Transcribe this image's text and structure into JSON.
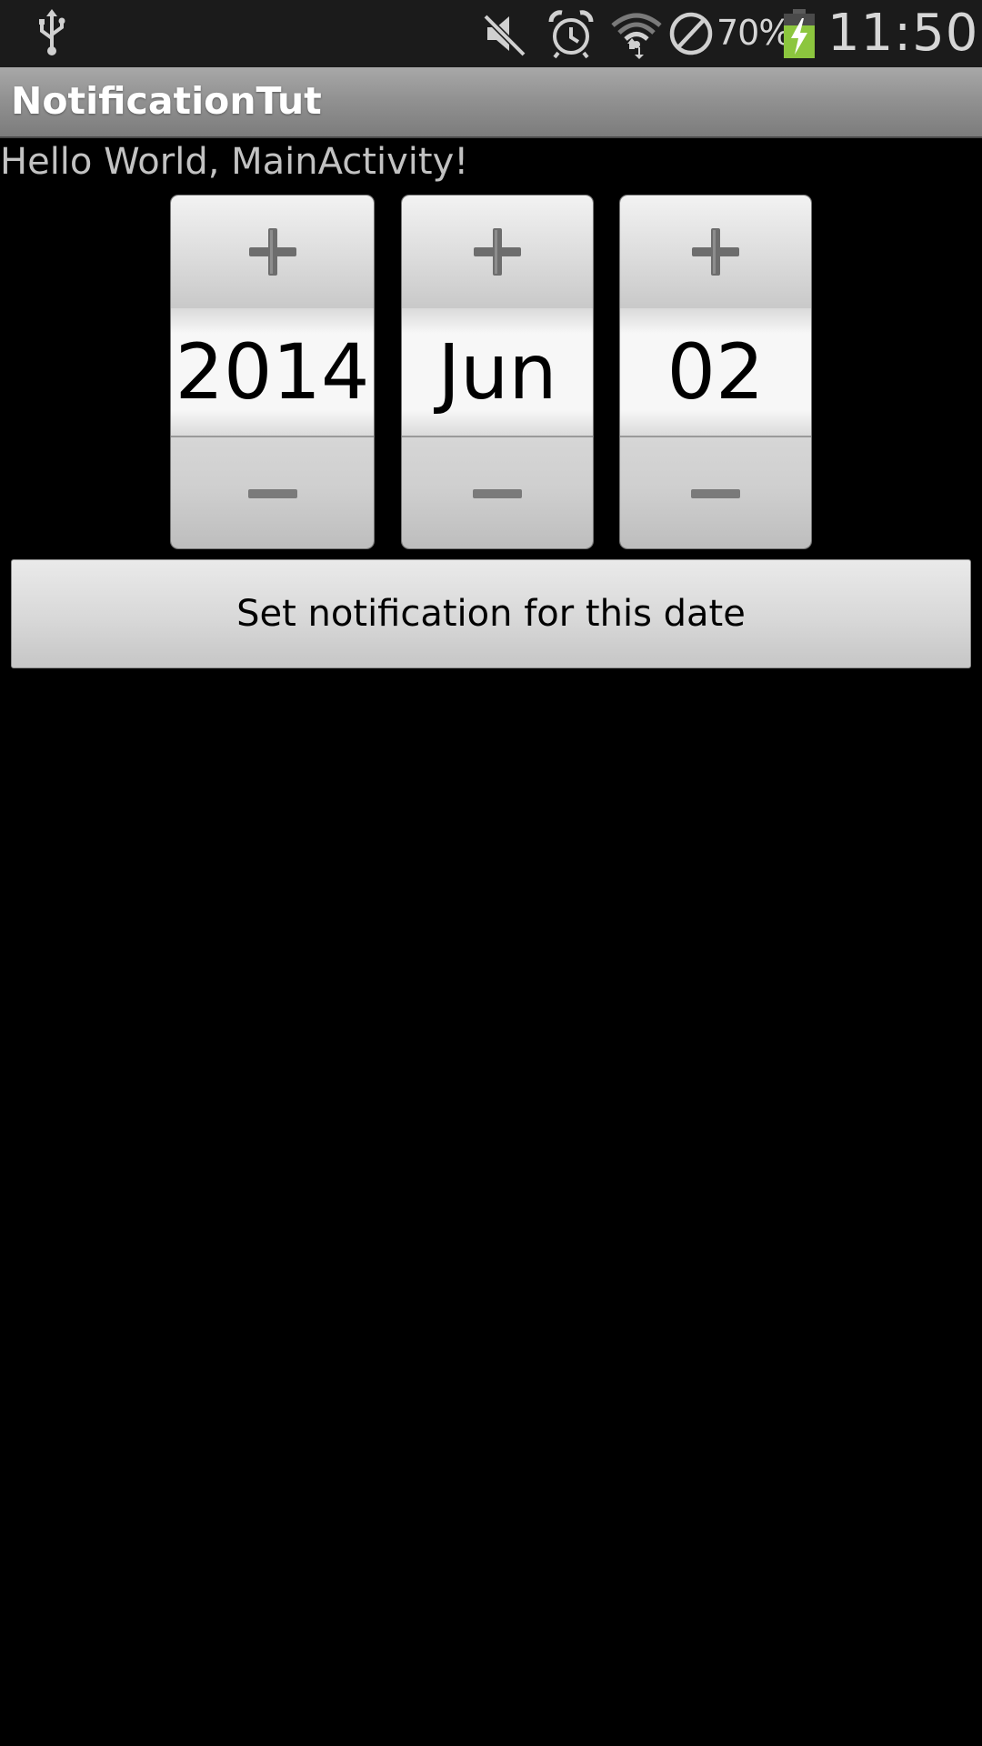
{
  "status_bar": {
    "icons": [
      "usb-icon",
      "mute-icon",
      "alarm-icon",
      "wifi-icon",
      "no-signal-icon",
      "battery-charging-icon"
    ],
    "battery_percent": "70%",
    "time": "11:50",
    "battery_color": "#8cc63e"
  },
  "title_bar": {
    "title": "NotificationTut"
  },
  "content": {
    "hello_text": "Hello World, MainActivity!"
  },
  "date_picker": {
    "year": "2014",
    "month": "Jun",
    "day": "02",
    "increment_icon": "plus-icon",
    "decrement_icon": "minus-icon"
  },
  "actions": {
    "set_notification_label": "Set notification for this date"
  }
}
